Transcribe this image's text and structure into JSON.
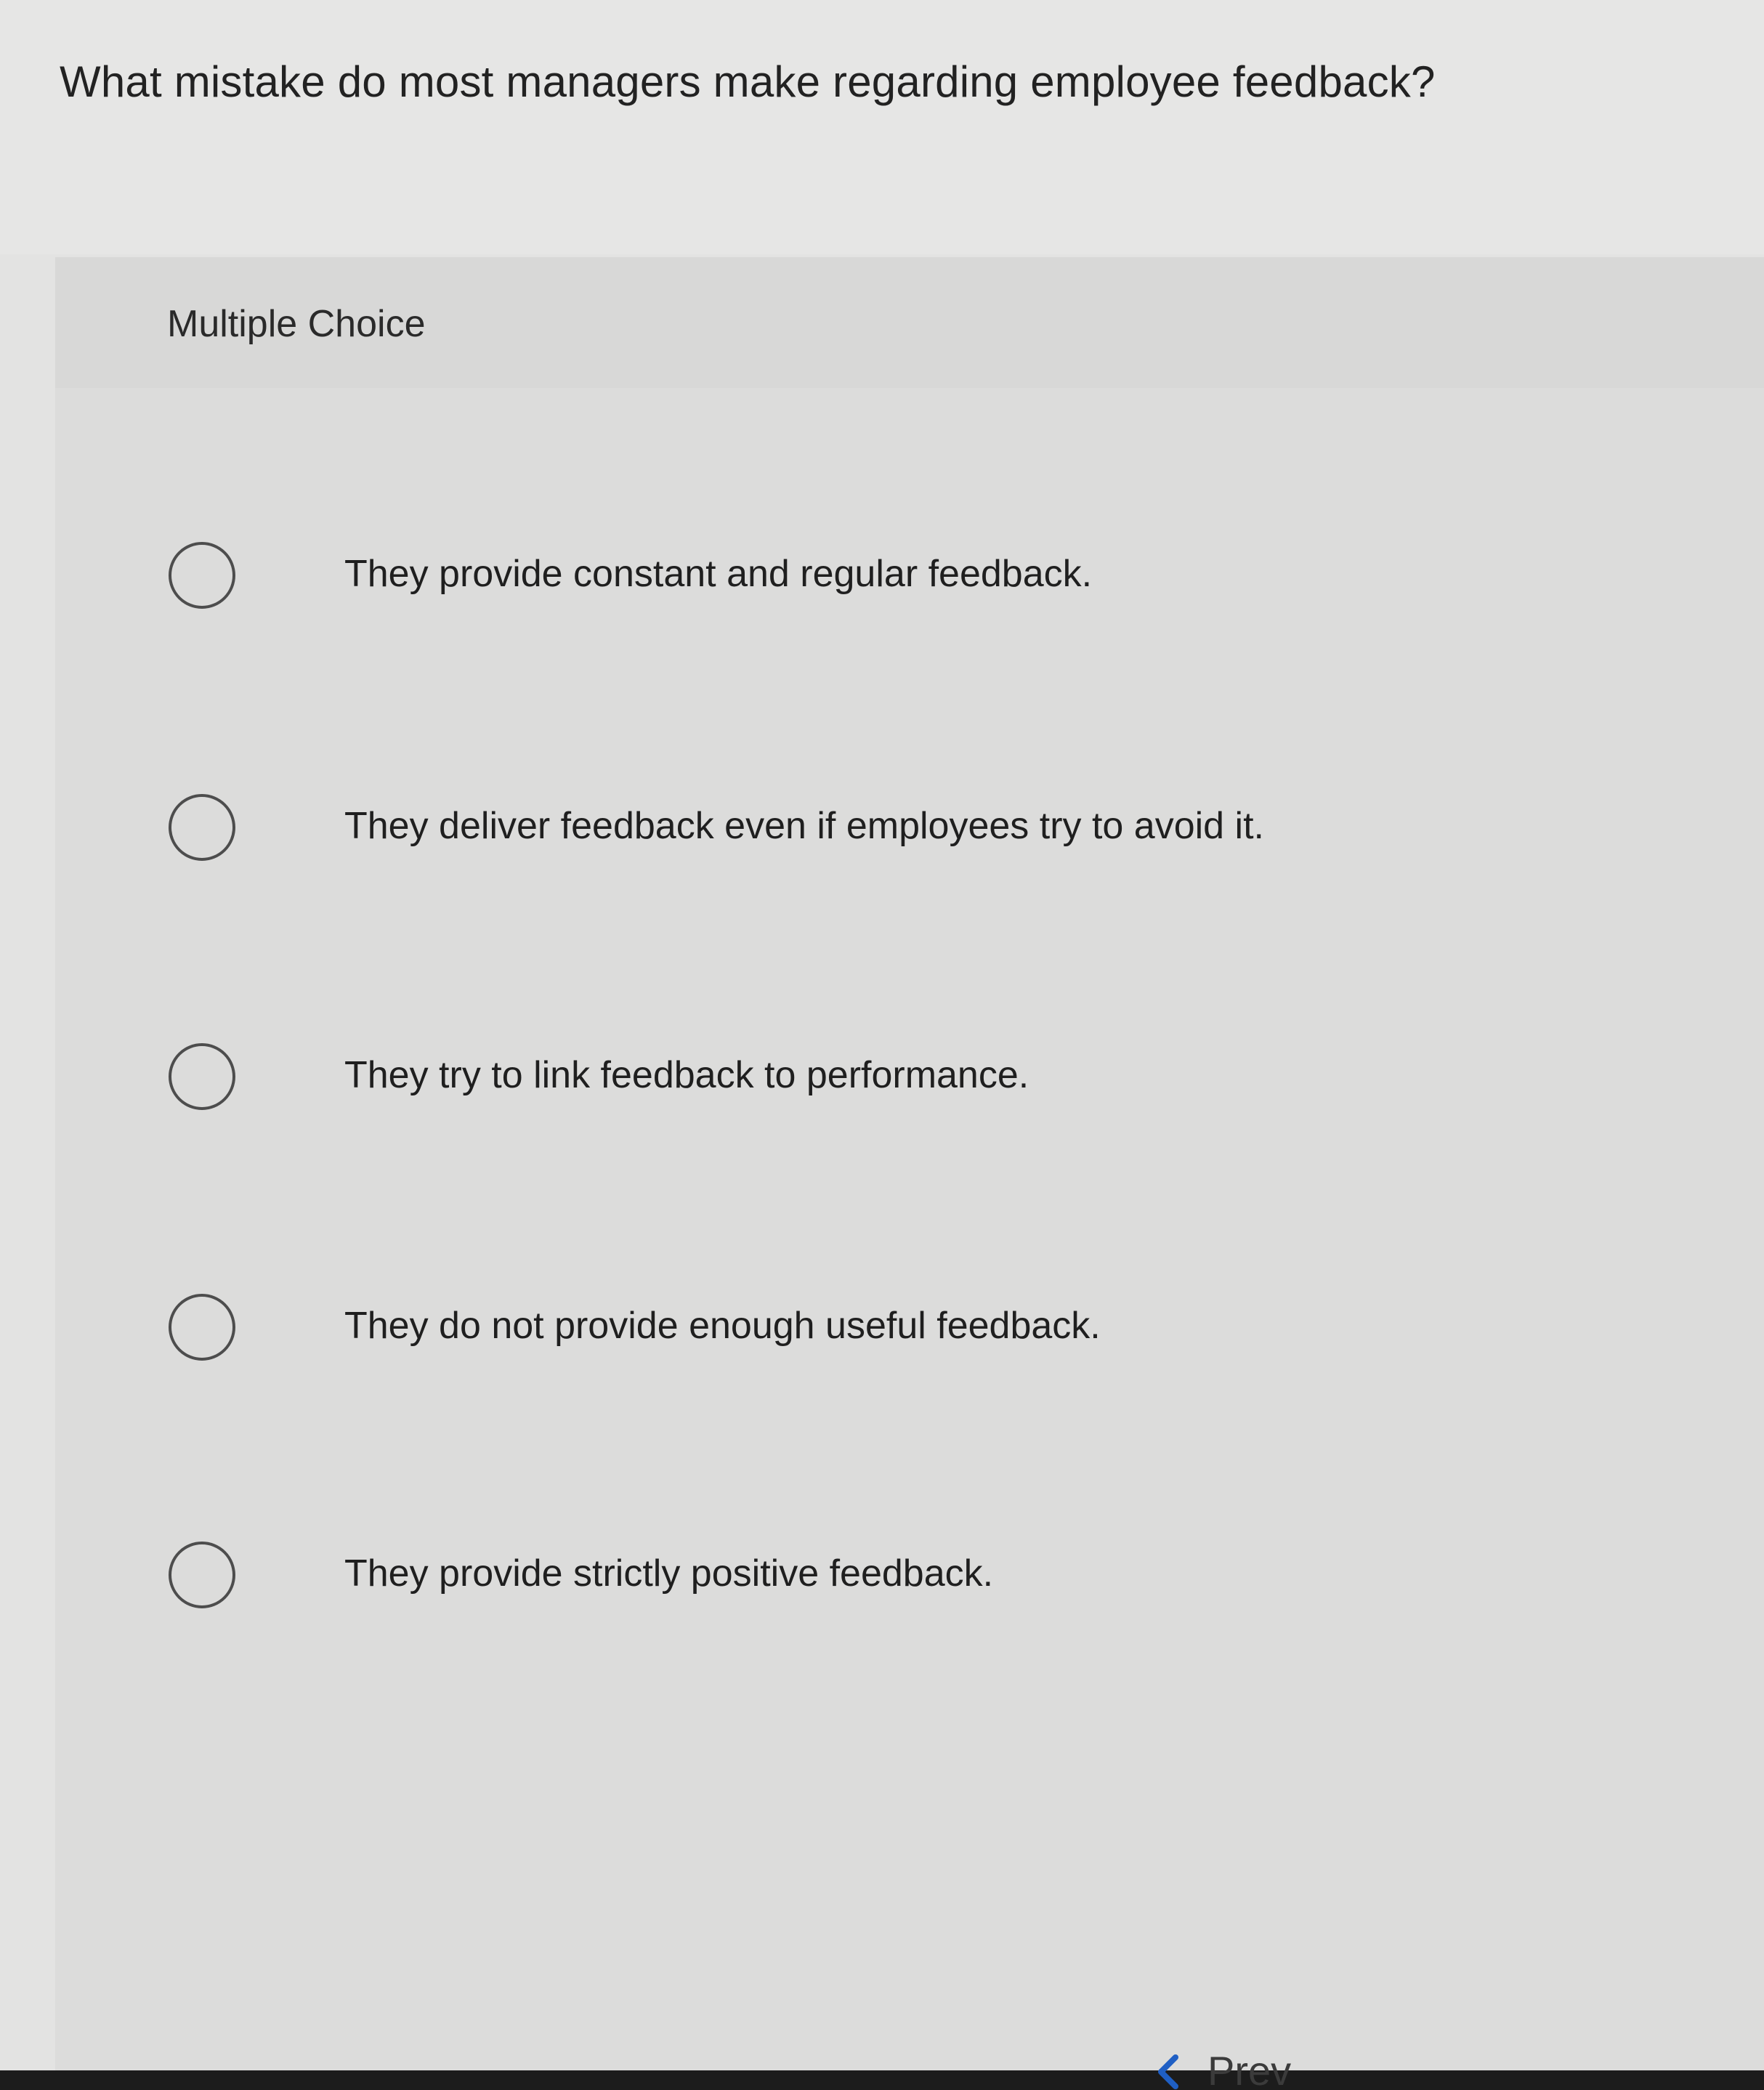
{
  "question": {
    "text": "What mistake do most managers make regarding employee feedback?"
  },
  "panel": {
    "label": "Multiple Choice"
  },
  "options": [
    {
      "label": "They provide constant and regular feedback."
    },
    {
      "label": "They deliver feedback even if employees try to avoid it."
    },
    {
      "label": "They try to link feedback to performance."
    },
    {
      "label": "They do not provide enough useful feedback."
    },
    {
      "label": "They provide strictly positive feedback."
    }
  ],
  "navigation": {
    "prev_label": "Prev",
    "prev_icon": "chevron-left-icon",
    "accent_color": "#1f5fc4"
  }
}
